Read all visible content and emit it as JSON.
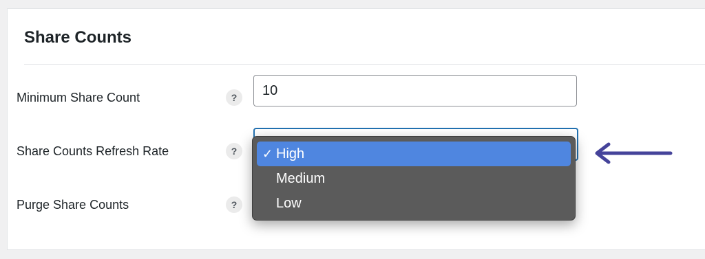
{
  "panel": {
    "title": "Share Counts"
  },
  "fields": {
    "minimum_share_count": {
      "label": "Minimum Share Count",
      "help": "?",
      "value": "10"
    },
    "refresh_rate": {
      "label": "Share Counts Refresh Rate",
      "help": "?",
      "options": [
        "High",
        "Medium",
        "Low"
      ],
      "selected": "High",
      "check": "✓"
    },
    "purge": {
      "label": "Purge Share Counts",
      "help": "?"
    }
  },
  "colors": {
    "highlight": "#4f86e0",
    "dropdown_bg": "#5b5b5b",
    "arrow": "#45439a",
    "focus_border": "#2271b1"
  },
  "icons": {
    "help": "help-icon",
    "check": "checkmark-icon",
    "annotation": "left-arrow-icon"
  }
}
